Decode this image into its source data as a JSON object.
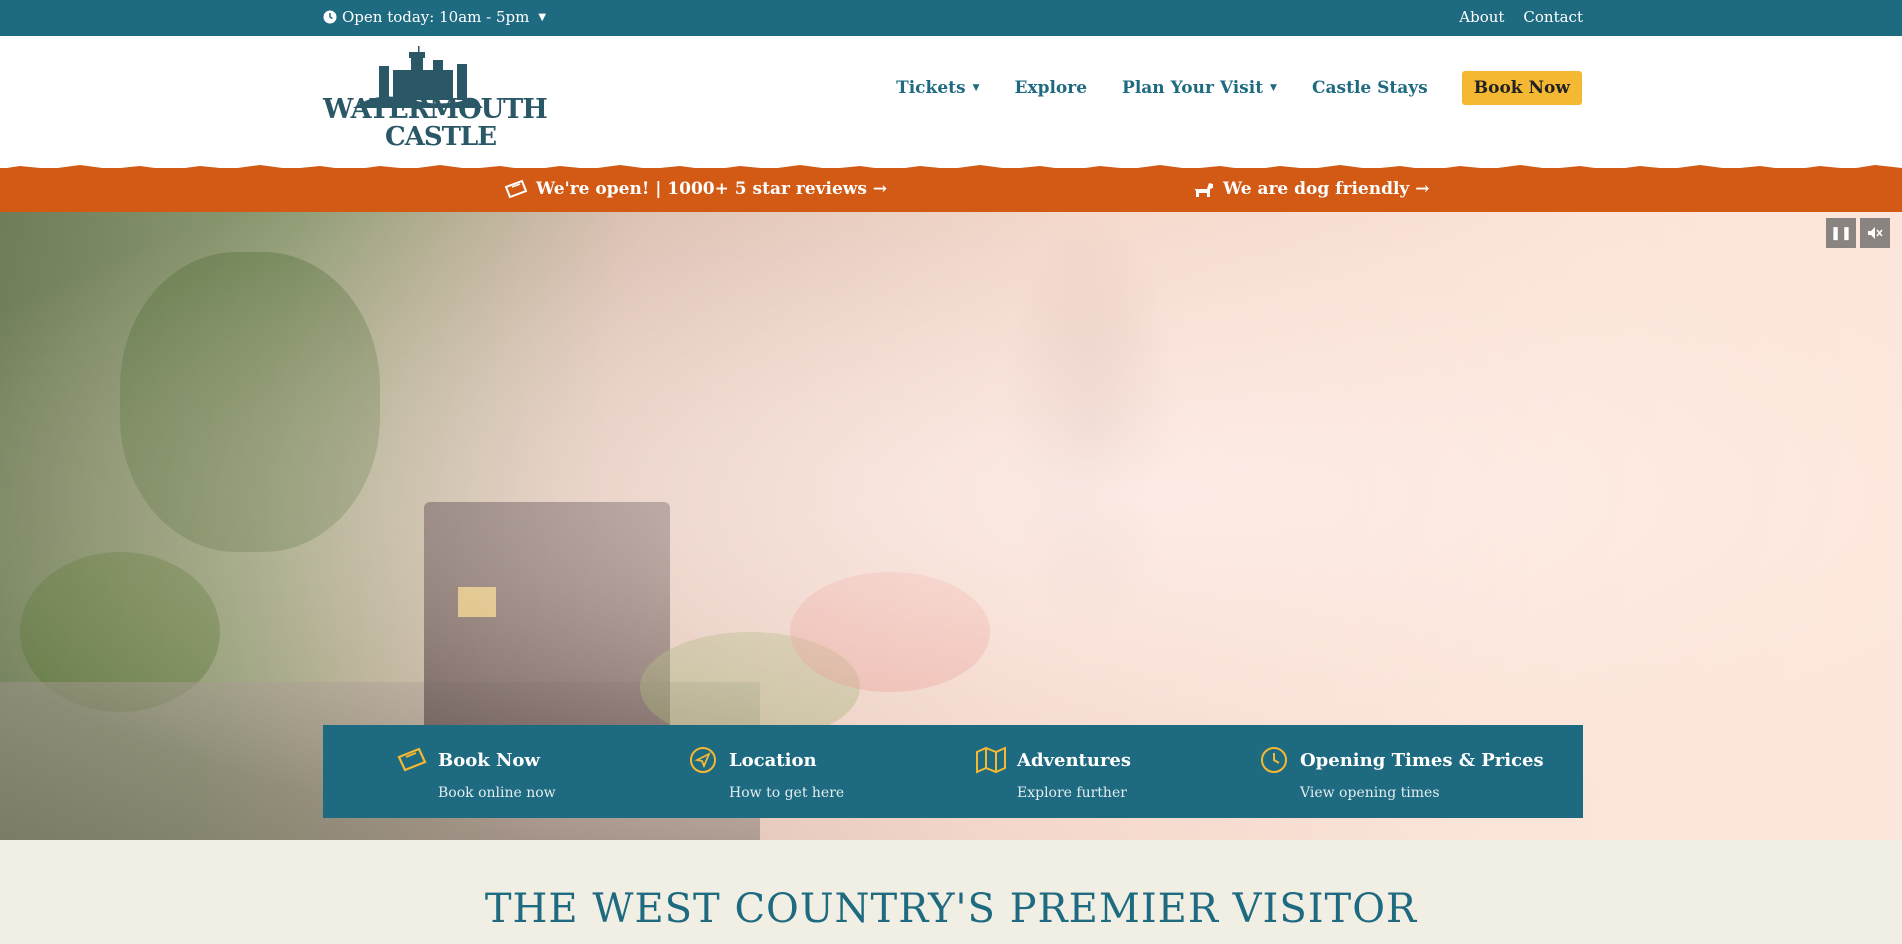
{
  "topbar": {
    "open_today": "Open today: 10am - 5pm",
    "links": [
      "About",
      "Contact"
    ]
  },
  "logo": {
    "line1": "WATERMOUTH",
    "line2": "CASTLE"
  },
  "nav": {
    "items": [
      "Tickets",
      "Explore",
      "Plan Your Visit",
      "Castle Stays"
    ],
    "book_now": "Book Now"
  },
  "promo": {
    "reviews": "We're open! | 1000+ 5 star reviews →",
    "dog": "We are dog friendly →"
  },
  "quick_links": [
    {
      "title": "Book Now",
      "subtitle": "Book online now",
      "icon": "ticket-icon"
    },
    {
      "title": "Location",
      "subtitle": "How to get here",
      "icon": "navigation-arrow-icon"
    },
    {
      "title": "Adventures",
      "subtitle": "Explore further",
      "icon": "map-icon"
    },
    {
      "title": "Opening Times & Prices",
      "subtitle": "View opening times",
      "icon": "clock-icon"
    }
  ],
  "section_heading": "THE WEST COUNTRY'S PREMIER VISITOR",
  "colors": {
    "teal": "#1e6a80",
    "orange": "#d25a14",
    "gold": "#f5b833"
  }
}
